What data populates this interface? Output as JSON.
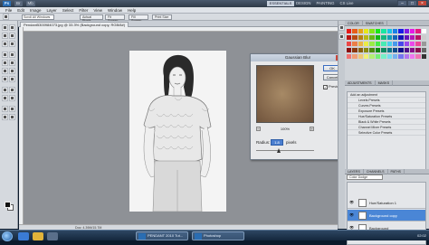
{
  "titlebar": {
    "logo": "Ps",
    "menu": [
      "Br",
      "Mb"
    ],
    "workspace": "ESSENTIALS",
    "right_items": [
      "DESIGN",
      "PAINTING",
      "CS Live"
    ]
  },
  "menubar": [
    "File",
    "Edit",
    "Image",
    "Layer",
    "Select",
    "Filter",
    "View",
    "Window",
    "Help"
  ],
  "options": {
    "scroll_all": "Scroll All Windows",
    "actual_pixels": "Actual Pixels",
    "fit_screen": "Fit Screen",
    "fill_screen": "Fill Screen",
    "print_size": "Print Size"
  },
  "document": {
    "tab": "Pendant5300984073.jpg @ 33.3% (Background copy, RGB/8#)",
    "status": "Doc: 4.39M/15.7M"
  },
  "dialog": {
    "title": "Gaussian Blur",
    "ok": "OK",
    "cancel": "Cancel",
    "preview_label": "Preview",
    "preview_checked": "✓",
    "zoom": "100%",
    "zoom_out": "−",
    "zoom_in": "+",
    "radius_label": "Radius:",
    "radius_value": "1.8",
    "radius_unit": "pixels"
  },
  "panels": {
    "swatch_tabs": [
      "COLOR",
      "SWATCHES"
    ],
    "adj_tabs": [
      "ADJUSTMENTS",
      "MASKS"
    ],
    "adj_title": "Add an adjustment",
    "adj_items": [
      "Levels Presets",
      "Curves Presets",
      "Exposure Presets",
      "Hue/Saturation Presets",
      "Black & White Presets",
      "Channel Mixer Presets",
      "Selective Color Presets"
    ],
    "layer_tabs": [
      "LAYERS",
      "CHANNELS",
      "PATHS"
    ],
    "blend_mode": "Color Dodge",
    "layers": [
      {
        "name": "Hue/Saturation 1",
        "selected": false
      },
      {
        "name": "Background copy",
        "selected": true
      },
      {
        "name": "Background",
        "selected": false
      }
    ]
  },
  "taskbar": {
    "tasks": [
      "PENDANT 2010 Tut...",
      "Photoshop"
    ],
    "time": "02:02"
  },
  "colors": {
    "accent": "#4a86d6",
    "titlebar": "#3b4757",
    "canvas_bg": "#8e9196"
  }
}
